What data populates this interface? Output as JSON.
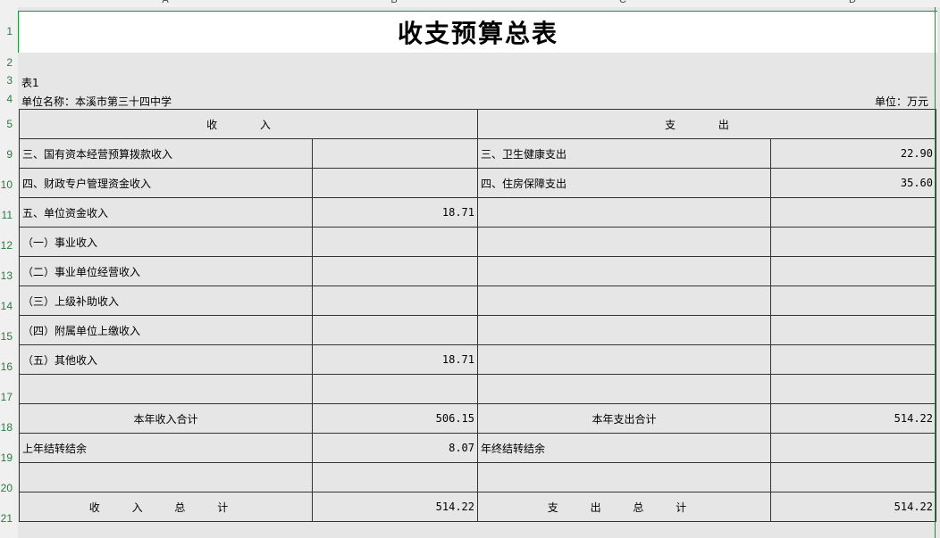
{
  "columns": [
    "A",
    "B",
    "C",
    "D"
  ],
  "row_numbers": [
    "1",
    "2",
    "3",
    "4",
    "5",
    "9",
    "10",
    "11",
    "12",
    "13",
    "14",
    "15",
    "16",
    "17",
    "18",
    "19",
    "20",
    "21"
  ],
  "title": "收支预算总表",
  "table_no": "表1",
  "unit_name": "单位名称：本溪市第三十四中学",
  "unit_label": "单位：万元",
  "headers": {
    "income": "收 入",
    "expense": "支 出"
  },
  "rows": [
    {
      "a": "三、国有资本经营预算拨款收入",
      "b": "",
      "c": "三、卫生健康支出",
      "d": "22.90"
    },
    {
      "a": "四、财政专户管理资金收入",
      "b": "",
      "c": "四、住房保障支出",
      "d": "35.60"
    },
    {
      "a": "五、单位资金收入",
      "b": "18.71",
      "c": "",
      "d": ""
    },
    {
      "a": "（一）事业收入",
      "b": "",
      "c": "",
      "d": ""
    },
    {
      "a": "（二）事业单位经营收入",
      "b": "",
      "c": "",
      "d": ""
    },
    {
      "a": "（三）上级补助收入",
      "b": "",
      "c": "",
      "d": ""
    },
    {
      "a": "（四）附属单位上缴收入",
      "b": "",
      "c": "",
      "d": ""
    },
    {
      "a": "（五）其他收入",
      "b": "18.71",
      "c": "",
      "d": ""
    },
    {
      "a": "",
      "b": "",
      "c": "",
      "d": ""
    }
  ],
  "year_total": {
    "income_label": "本年收入合计",
    "income_value": "506.15",
    "expense_label": "本年支出合计",
    "expense_value": "514.22"
  },
  "carry": {
    "income_label": "上年结转结余",
    "income_value": "8.07",
    "expense_label": "年终结转结余",
    "expense_value": ""
  },
  "grand_total": {
    "income_label": "收 入 总 计",
    "income_value": "514.22",
    "expense_label": "支 出 总 计",
    "expense_value": "514.22"
  },
  "colors": {
    "accent": "#1f8b3e",
    "grid_bg": "#e6e6e6"
  }
}
